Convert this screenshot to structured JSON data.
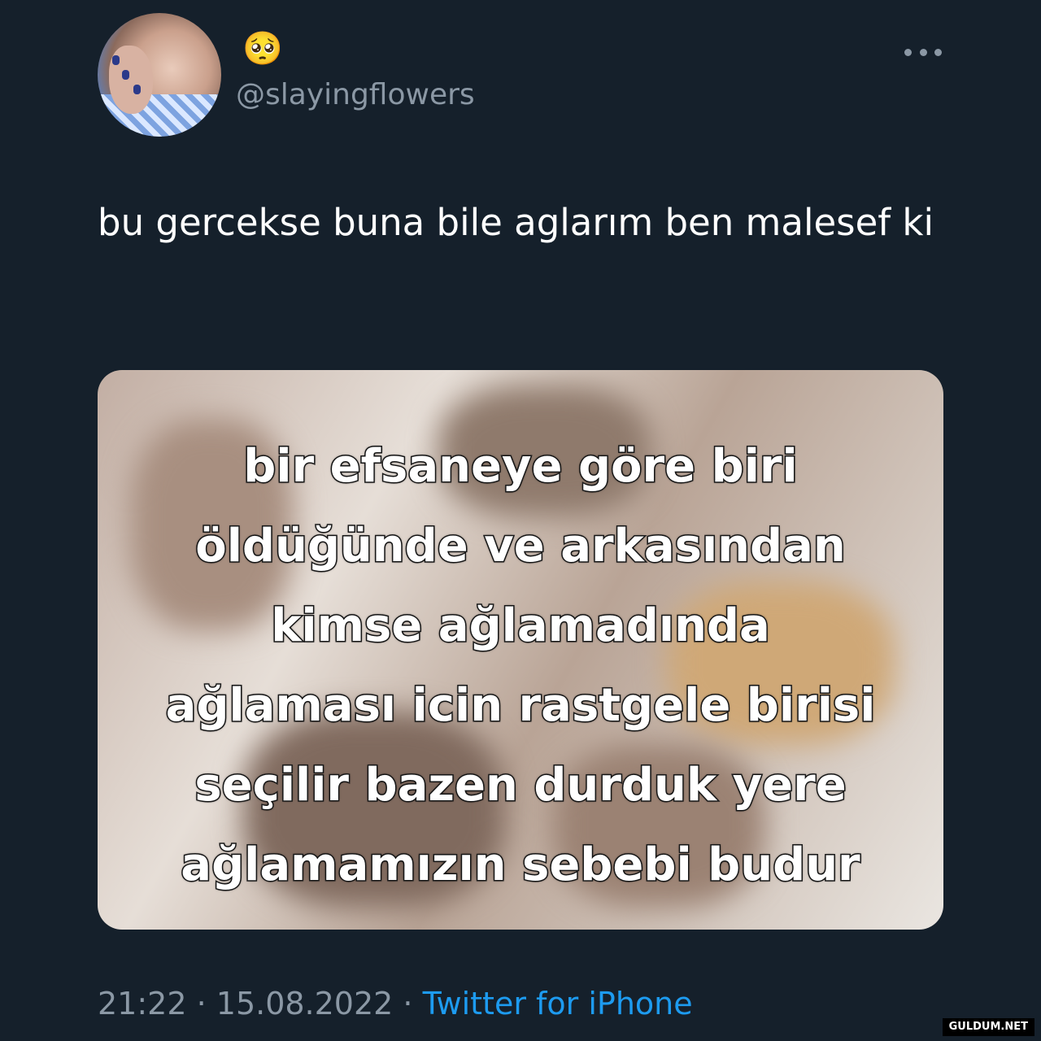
{
  "author": {
    "display_name": "🥺",
    "handle": "@slayingflowers"
  },
  "tweet": {
    "text": "bu gercekse buna bile aglarım ben malesef ki"
  },
  "media": {
    "caption_lines": [
      "bir efsaneye göre biri",
      "öldüğünde ve arkasından",
      "kimse ağlamadında",
      "ağlaması icin rastgele birisi",
      "seçilir bazen durduk yere",
      "ağlamamızın sebebi budur"
    ]
  },
  "meta": {
    "time": "21:22",
    "separator1": " · ",
    "date": "15.08.2022",
    "separator2": " · ",
    "source": "Twitter for iPhone"
  },
  "watermark": "GULDUM.NET",
  "colors": {
    "background": "#15202b",
    "text_primary": "#ffffff",
    "text_secondary": "#8b98a5",
    "link": "#1d9bf0"
  }
}
